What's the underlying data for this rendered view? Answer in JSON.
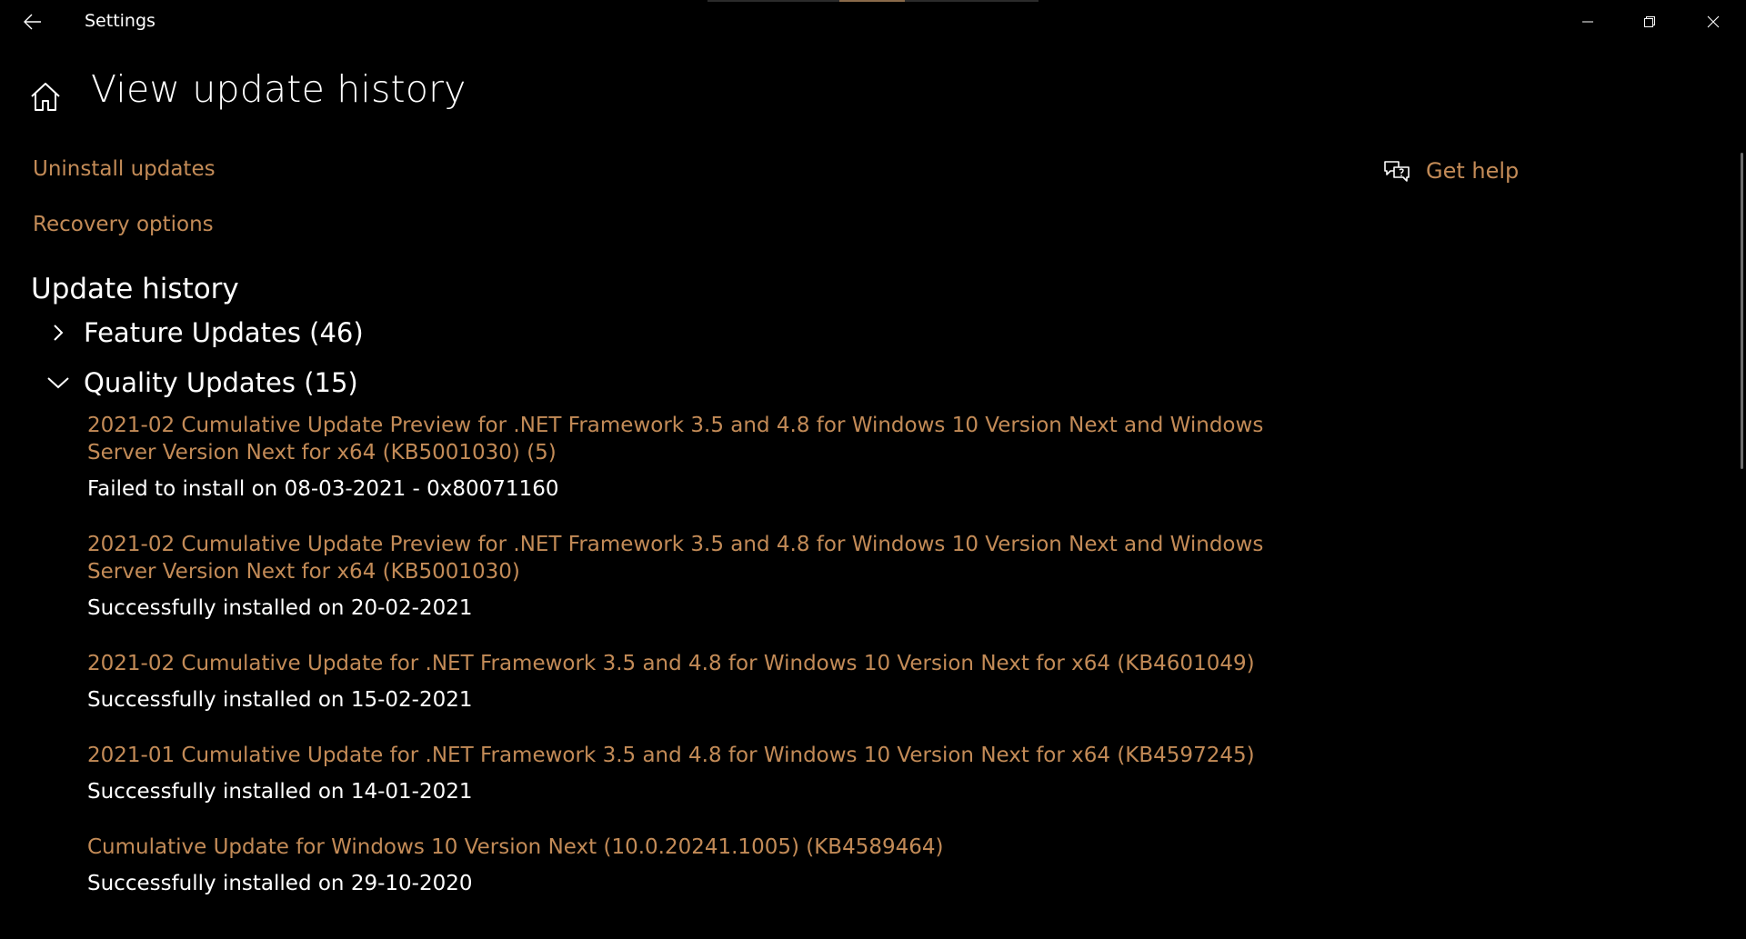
{
  "window": {
    "title": "Settings"
  },
  "header": {
    "title": "View update history"
  },
  "links": {
    "uninstall": "Uninstall updates",
    "recovery": "Recovery options",
    "help": "Get help"
  },
  "history": {
    "title": "Update history",
    "groups": [
      {
        "label": "Feature Updates (46)",
        "expanded": false
      },
      {
        "label": "Quality Updates (15)",
        "expanded": true
      }
    ],
    "updates": [
      {
        "title": "2021-02 Cumulative Update Preview for .NET Framework 3.5 and 4.8 for Windows 10 Version Next and Windows Server Version Next for x64 (KB5001030) (5)",
        "status": "Failed to install on 08-03-2021 - 0x80071160"
      },
      {
        "title": "2021-02 Cumulative Update Preview for .NET Framework 3.5 and 4.8 for Windows 10 Version Next and Windows Server Version Next for x64 (KB5001030)",
        "status": "Successfully installed on 20-02-2021"
      },
      {
        "title": "2021-02 Cumulative Update for .NET Framework 3.5 and 4.8 for Windows 10 Version Next for x64 (KB4601049)",
        "status": "Successfully installed on 15-02-2021"
      },
      {
        "title": "2021-01 Cumulative Update for .NET Framework 3.5 and 4.8 for Windows 10 Version Next for x64 (KB4597245)",
        "status": "Successfully installed on 14-01-2021"
      },
      {
        "title": "Cumulative Update for Windows 10 Version Next (10.0.20241.1005) (KB4589464)",
        "status": "Successfully installed on 29-10-2020"
      }
    ]
  },
  "colors": {
    "accent_link": "#c38b57",
    "background": "#000000",
    "text": "#ffffff"
  },
  "icons": {
    "back": "back-arrow-icon",
    "home": "home-icon",
    "help": "chat-help-icon",
    "minimize": "minimize-icon",
    "restore": "restore-icon",
    "close": "close-icon",
    "collapsed": "chevron-right-icon",
    "expanded": "chevron-down-icon"
  }
}
